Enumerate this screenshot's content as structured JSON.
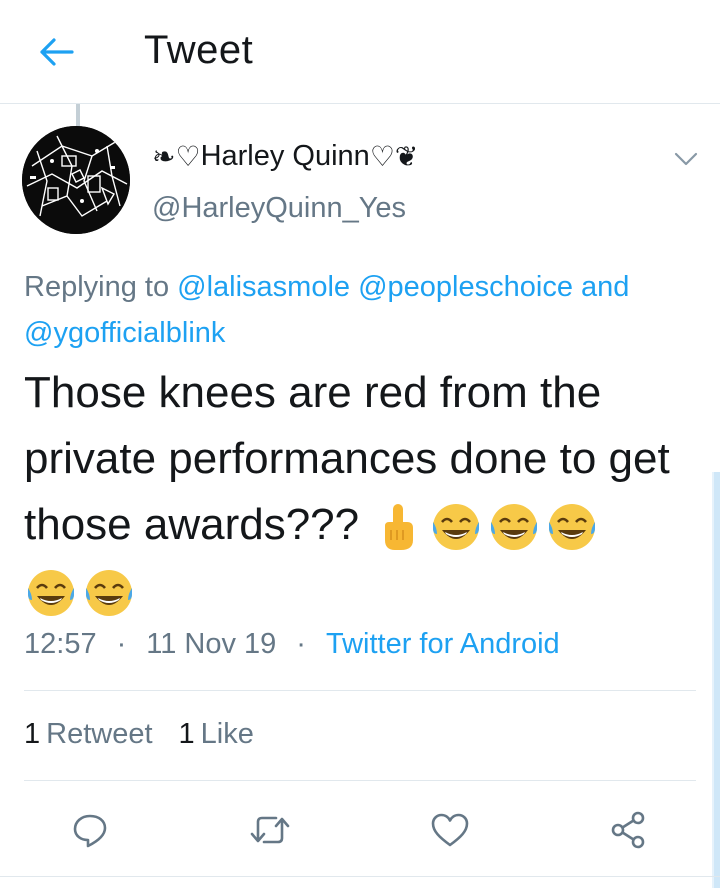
{
  "header": {
    "title": "Tweet"
  },
  "author": {
    "display_name": "Harley Quinn",
    "deco_left": "❧♡",
    "deco_right": "♡❦",
    "handle": "@HarleyQuinn_Yes"
  },
  "reply": {
    "prefix": "Replying to ",
    "mention1": "@lalisasmole",
    "mention2": "@peopleschoice",
    "joiner": " and ",
    "mention3": "@ygofficialblink"
  },
  "tweet": {
    "text": "Those knees are red from the private performances done to get those awards??? ",
    "emojis": [
      "point-up-emoji",
      "joy-emoji",
      "joy-emoji",
      "joy-emoji",
      "joy-emoji",
      "joy-emoji"
    ]
  },
  "meta": {
    "time": "12:57",
    "sep1": "·",
    "date": "11 Nov 19",
    "sep2": "·",
    "source": "Twitter for Android"
  },
  "stats": {
    "retweet_count": "1",
    "retweet_label": "Retweet",
    "like_count": "1",
    "like_label": "Like"
  },
  "colors": {
    "accent": "#1da1f2",
    "secondary": "#657786",
    "border": "#e1e8ed"
  }
}
